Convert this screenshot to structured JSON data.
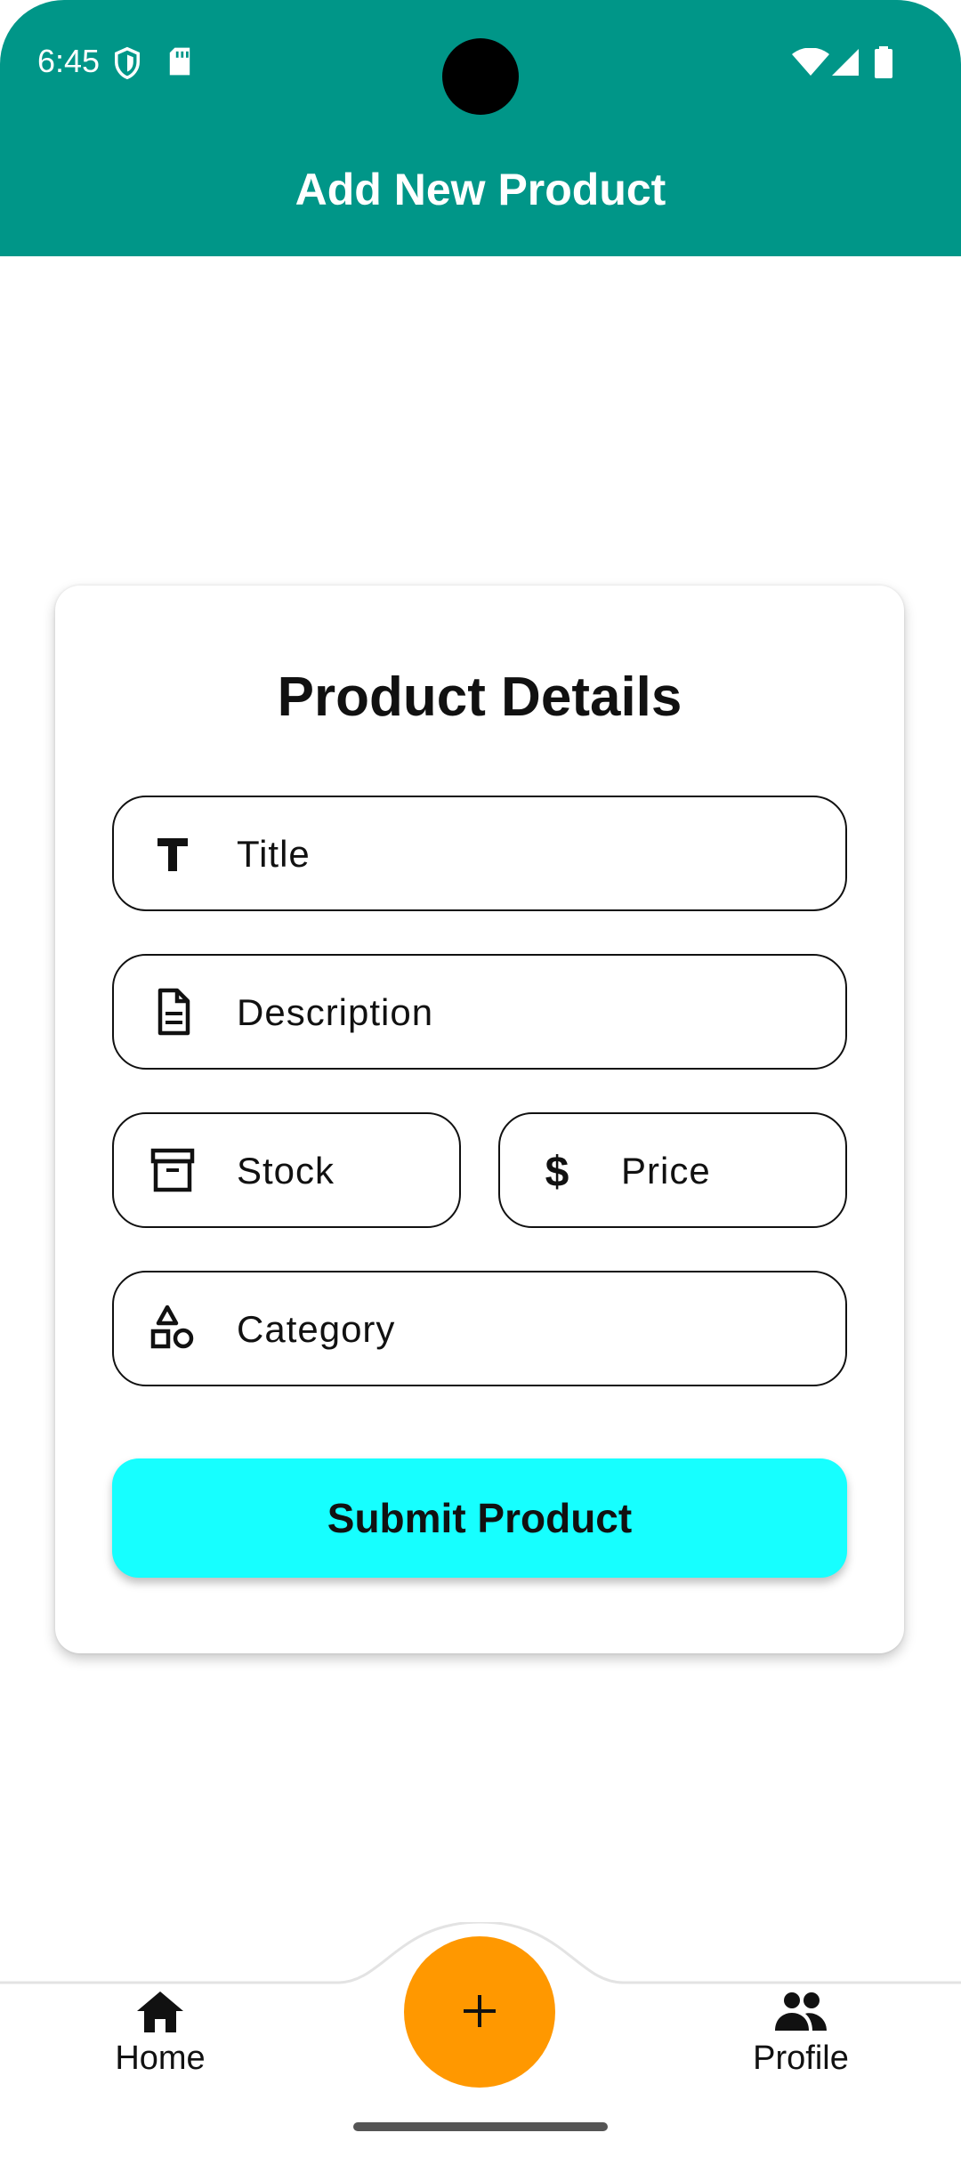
{
  "status_bar": {
    "time": "6:45",
    "icons": [
      "shield-icon",
      "sd-card-icon",
      "wifi-icon",
      "signal-icon",
      "battery-icon"
    ]
  },
  "app_bar": {
    "title": "Add New Product",
    "color": "#009688"
  },
  "form": {
    "title": "Product Details",
    "fields": {
      "title": {
        "placeholder": "Title",
        "icon": "title-icon"
      },
      "description": {
        "placeholder": "Description",
        "icon": "document-icon"
      },
      "stock": {
        "placeholder": "Stock",
        "icon": "archive-box-icon"
      },
      "price": {
        "placeholder": "Price",
        "icon": "dollar-icon"
      },
      "category": {
        "placeholder": "Category",
        "icon": "shapes-icon"
      }
    },
    "submit_label": "Submit Product",
    "submit_color": "#16ffff"
  },
  "bottom_nav": {
    "items": [
      {
        "label": "Home",
        "icon": "home-icon"
      },
      {
        "label": "Profile",
        "icon": "people-icon"
      }
    ],
    "fab": {
      "icon": "plus-icon",
      "color": "#ff9800"
    }
  }
}
